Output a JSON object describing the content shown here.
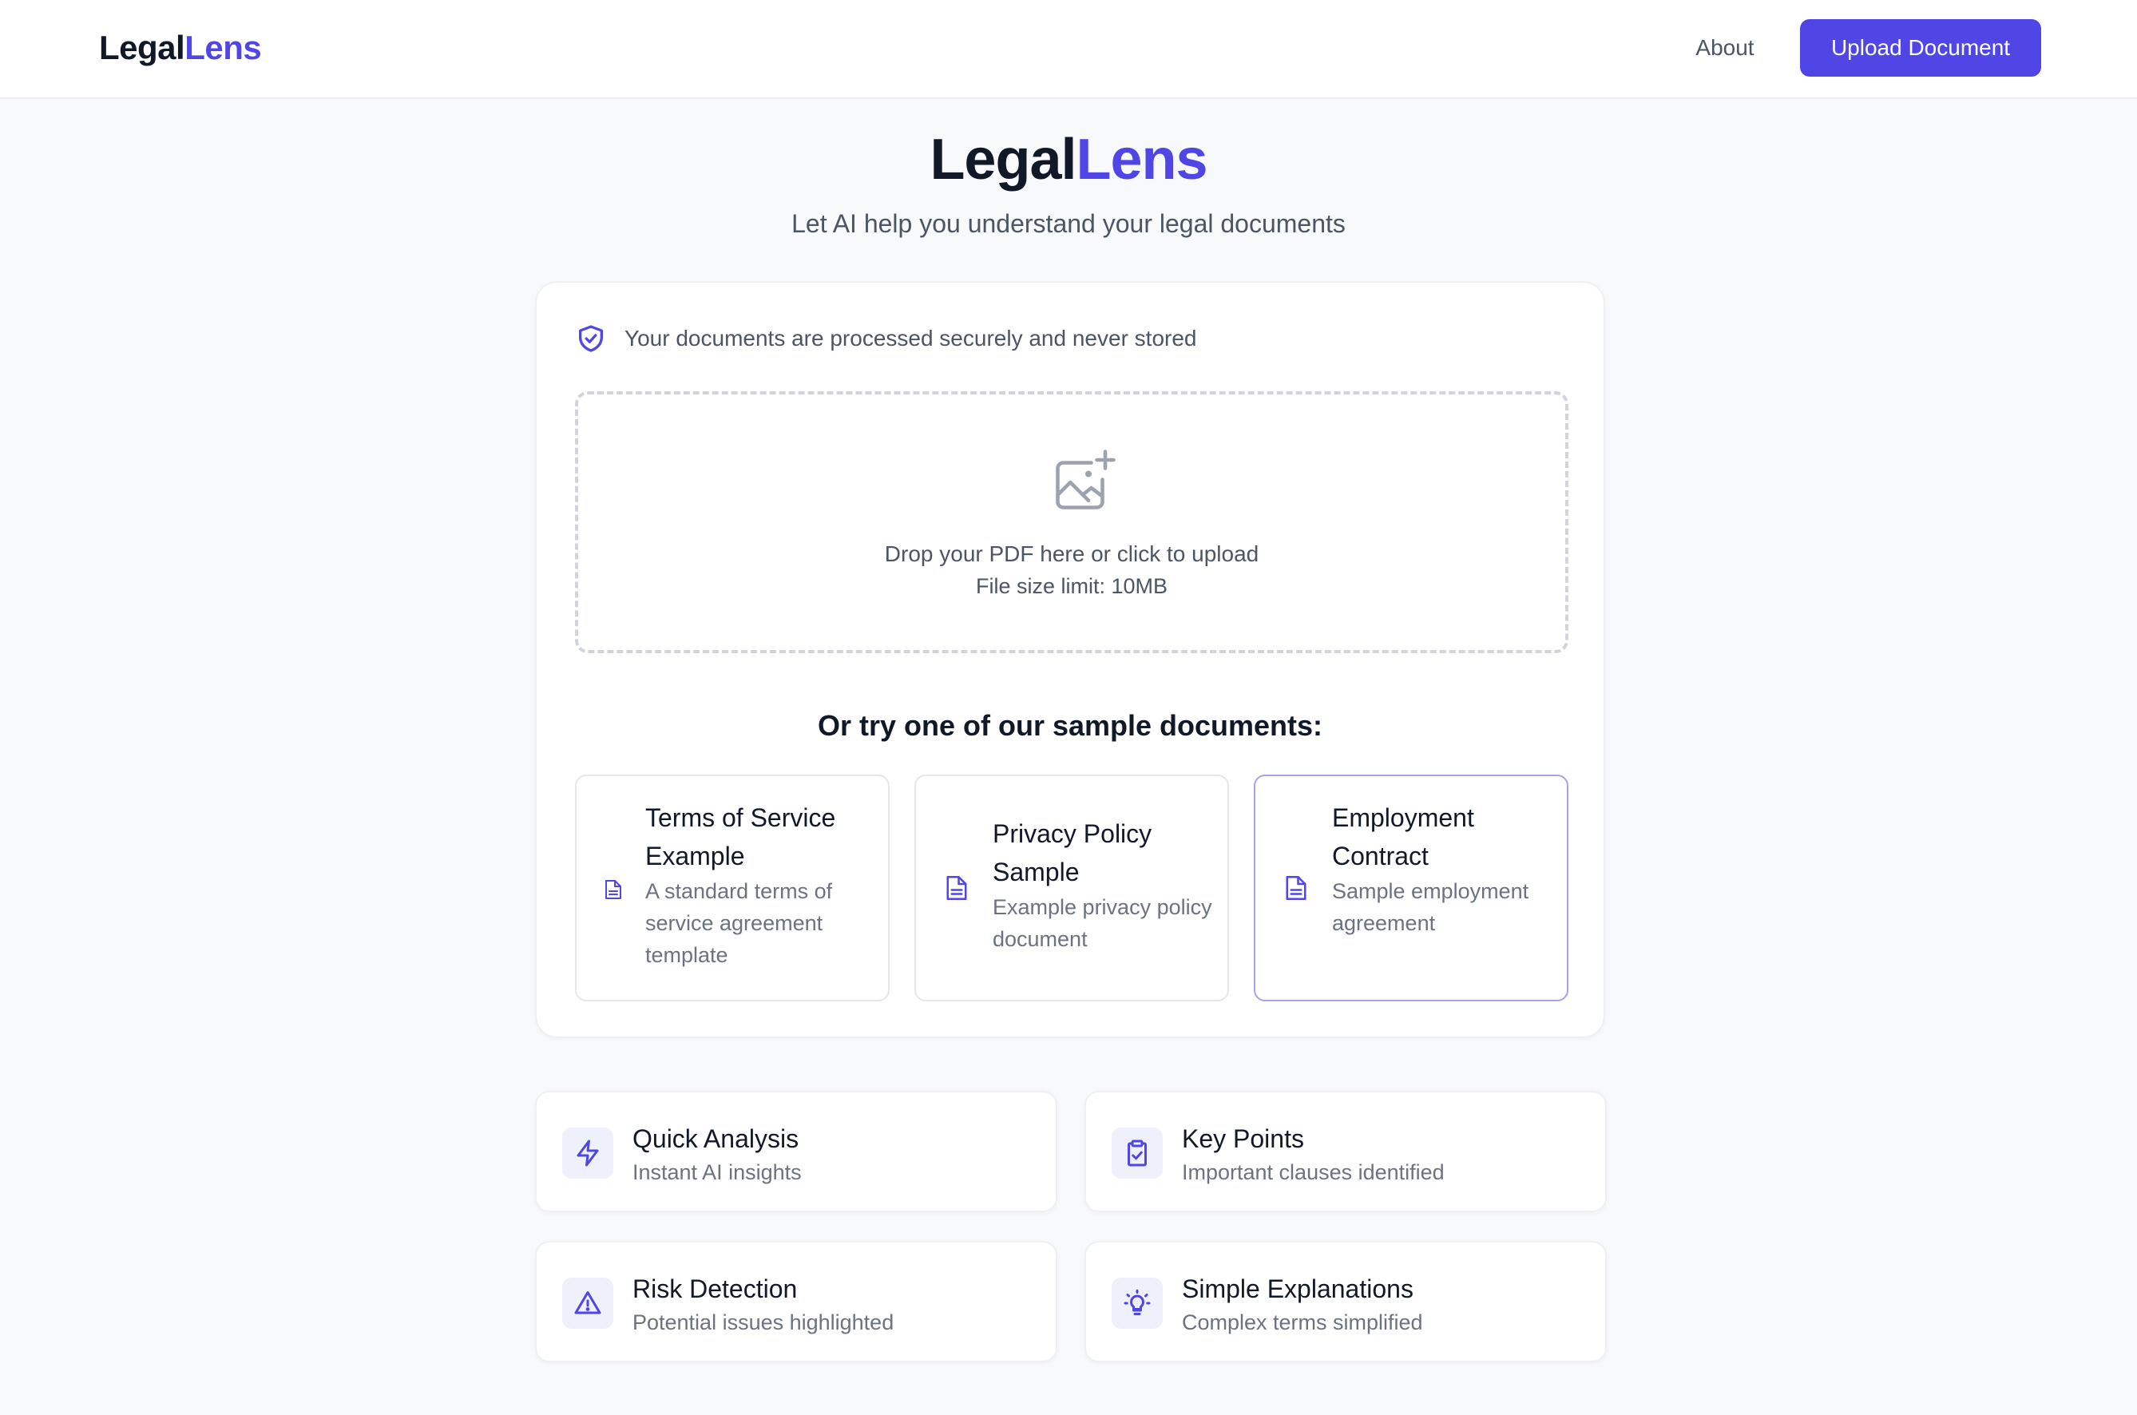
{
  "nav": {
    "brand_first": "Legal",
    "brand_second": "Lens",
    "about_label": "About",
    "upload_label": "Upload Document"
  },
  "hero": {
    "title_first": "Legal",
    "title_second": "Lens",
    "subtitle": "Let AI help you understand your legal documents"
  },
  "upload": {
    "security_icon": "shield-check-icon",
    "security_text": "Your documents are processed securely and never stored",
    "drop_icon": "image-plus-icon",
    "drop_text": "Drop your PDF here or click to upload",
    "size_limit": "File size limit: 10MB"
  },
  "samples": {
    "heading": "Or try one of our sample documents:",
    "items": [
      {
        "title": "Terms of Service Example",
        "description": "A standard terms of service agreement template",
        "icon": "document-icon"
      },
      {
        "title": "Privacy Policy Sample",
        "description": "Example privacy policy document",
        "icon": "document-icon"
      },
      {
        "title": "Employment Contract",
        "description": "Sample employment agreement",
        "icon": "document-icon"
      }
    ]
  },
  "features": [
    {
      "title": "Quick Analysis",
      "subtitle": "Instant AI insights",
      "icon": "lightning-icon"
    },
    {
      "title": "Key Points",
      "subtitle": "Important clauses identified",
      "icon": "clipboard-check-icon"
    },
    {
      "title": "Risk Detection",
      "subtitle": "Potential issues highlighted",
      "icon": "warning-triangle-icon"
    },
    {
      "title": "Simple Explanations",
      "subtitle": "Complex terms simplified",
      "icon": "lightbulb-icon"
    }
  ],
  "colors": {
    "accent": "#4f46e5",
    "page_background": "#f8f9fb",
    "text_primary": "#111827",
    "text_secondary": "#4b5563",
    "text_muted": "#6b7280"
  }
}
